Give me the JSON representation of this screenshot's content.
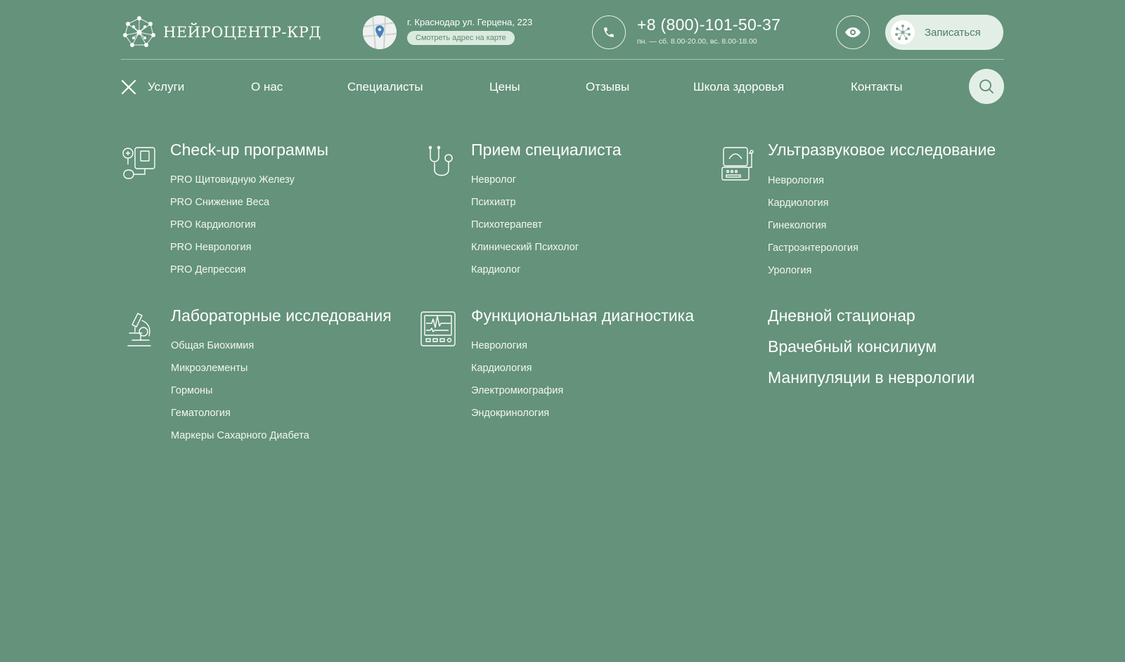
{
  "header": {
    "logo_text": "НЕЙРОЦЕНТР-КРД",
    "address": "г. Краснодар ул. Герцена, 223",
    "map_link": "Смотреть адрес на карте",
    "phone": "+8 (800)-101-50-37",
    "hours": "пн. — сб. 8.00-20.00, вс. 8.00-18.00",
    "signup_label": "Записаться"
  },
  "nav": {
    "items": [
      "Услуги",
      "О нас",
      "Специалисты",
      "Цены",
      "Отзывы",
      "Школа здоровья",
      "Контакты"
    ]
  },
  "menu": {
    "checkup": {
      "title": "Check-up программы",
      "links": [
        "PRO Щитовидную Железу",
        "PRO Снижение Веса",
        "PRO Кардиология",
        "PRO Неврология",
        "PRO Депрессия"
      ]
    },
    "specialist": {
      "title": "Прием специалиста",
      "links": [
        "Невролог",
        "Психиатр",
        "Психотерапевт",
        "Клинический Психолог",
        "Кардиолог"
      ]
    },
    "ultrasound": {
      "title": "Ультразвуковое исследование",
      "links": [
        "Неврология",
        "Кардиология",
        "Гинекология",
        "Гастроэнтерология",
        "Урология"
      ]
    },
    "lab": {
      "title": "Лабораторные исследования",
      "links": [
        "Общая Биохимия",
        "Микроэлементы",
        "Гормоны",
        "Гематология",
        "Маркеры Сахарного Диабета"
      ]
    },
    "functional": {
      "title": "Функциональная диагностика",
      "links": [
        "Неврология",
        "Кардиология",
        "Электромиография",
        "Эндокринология"
      ]
    },
    "extra": {
      "day_hospital": "Дневной стационар",
      "consilium": "Врачебный консилиум",
      "manipulations": "Манипуляции в неврологии"
    }
  },
  "colors": {
    "background": "#64927a",
    "accent_light": "#e3efe6",
    "accent_text": "#4f7d64"
  }
}
